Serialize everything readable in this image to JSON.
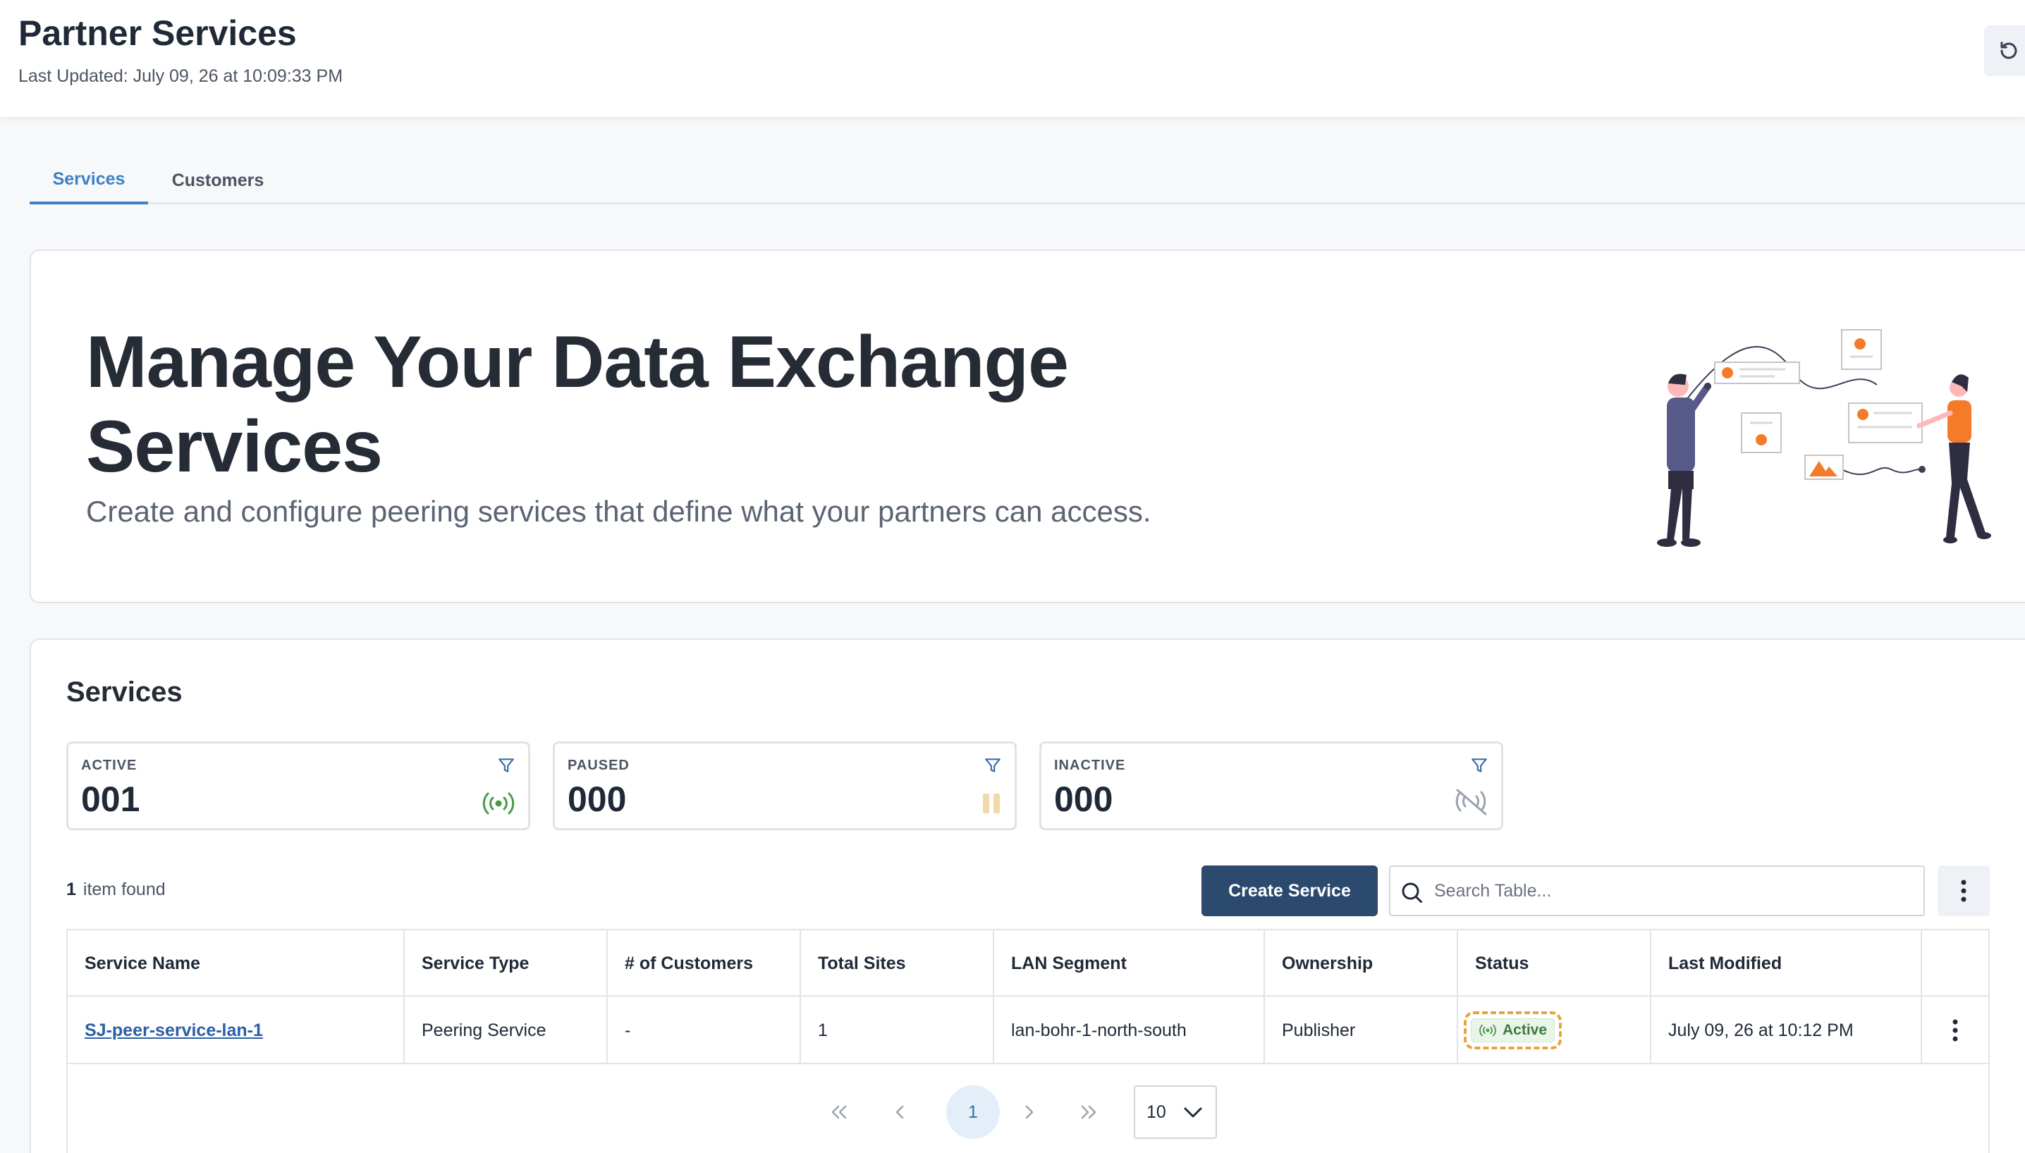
{
  "header": {
    "title": "Partner Services",
    "last_updated": "Last Updated: July 09, 26 at 10:09:33 PM",
    "refresh_icon": "refresh-icon"
  },
  "tabs": [
    {
      "label": "Services",
      "active": true
    },
    {
      "label": "Customers",
      "active": false
    }
  ],
  "hero": {
    "title": "Manage Your Data Exchange Services",
    "subtitle": "Create and configure peering services that define what your partners can access."
  },
  "services": {
    "title": "Services",
    "stats": [
      {
        "label": "ACTIVE",
        "value": "001",
        "icon": "broadcast-icon",
        "color": "#4a9a4a"
      },
      {
        "label": "PAUSED",
        "value": "000",
        "icon": "pause-icon",
        "color": "#f3d9a8"
      },
      {
        "label": "INACTIVE",
        "value": "000",
        "icon": "broadcast-off-icon",
        "color": "#9ca3af"
      }
    ],
    "items_count": "1",
    "items_text": "item found",
    "create_button": "Create Service",
    "search_placeholder": "Search Table...",
    "columns": [
      "Service Name",
      "Service Type",
      "# of Customers",
      "Total Sites",
      "LAN Segment",
      "Ownership",
      "Status",
      "Last Modified"
    ],
    "rows": [
      {
        "service_name": "SJ-peer-service-lan-1",
        "service_type": "Peering Service",
        "customers": "-",
        "total_sites": "1",
        "lan_segment": "lan-bohr-1-north-south",
        "ownership": "Publisher",
        "status": "Active",
        "last_modified": "July 09, 26 at 10:12 PM"
      }
    ],
    "pagination": {
      "current_page": "1",
      "page_size": "10"
    }
  },
  "colors": {
    "accent": "#3b82c4",
    "primary_button": "#2c4a6e",
    "status_active": "#3d7a3d",
    "highlight": "#e8a33d"
  }
}
